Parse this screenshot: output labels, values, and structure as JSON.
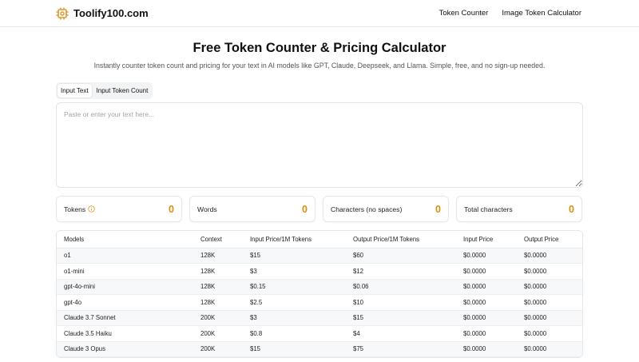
{
  "header": {
    "brand": "Toolify100.com",
    "nav": [
      "Token Counter",
      "Image Token Calculator"
    ]
  },
  "hero": {
    "title": "Free Token Counter & Pricing Calculator",
    "subtitle": "Instantly counter token count and pricing for your text in AI models like GPT, Claude, Deepseek, and Llama. Simple, free, and no sign-up needed."
  },
  "tabs": [
    "Input Text",
    "Input Token Count"
  ],
  "input": {
    "placeholder": "Paste or enter your text here...",
    "value": ""
  },
  "stats": [
    {
      "label": "Tokens",
      "value": "0"
    },
    {
      "label": "Words",
      "value": "0"
    },
    {
      "label": "Characters (no spaces)",
      "value": "0"
    },
    {
      "label": "Total characters",
      "value": "0"
    }
  ],
  "table": {
    "headers": [
      "Models",
      "Context",
      "Input Price/1M Tokens",
      "Output Price/1M Tokens",
      "Input Price",
      "Output Price"
    ],
    "rows": [
      [
        "o1",
        "128K",
        "$15",
        "$60",
        "$0.0000",
        "$0.0000"
      ],
      [
        "o1-mini",
        "128K",
        "$3",
        "$12",
        "$0.0000",
        "$0.0000"
      ],
      [
        "gpt-4o-mini",
        "128K",
        "$0.15",
        "$0.06",
        "$0.0000",
        "$0.0000"
      ],
      [
        "gpt-4o",
        "128K",
        "$2.5",
        "$10",
        "$0.0000",
        "$0.0000"
      ],
      [
        "Claude 3.7 Sonnet",
        "200K",
        "$3",
        "$15",
        "$0.0000",
        "$0.0000"
      ],
      [
        "Claude 3.5 Haiku",
        "200K",
        "$0.8",
        "$4",
        "$0.0000",
        "$0.0000"
      ],
      [
        "Claude 3 Opus",
        "200K",
        "$15",
        "$75",
        "$0.0000",
        "$0.0000"
      ]
    ]
  },
  "colors": {
    "accent": "#d98f10",
    "brand_icon": "#e0982a"
  },
  "icons": {
    "brand": "gear-icon",
    "tokens_info": "info-icon"
  }
}
